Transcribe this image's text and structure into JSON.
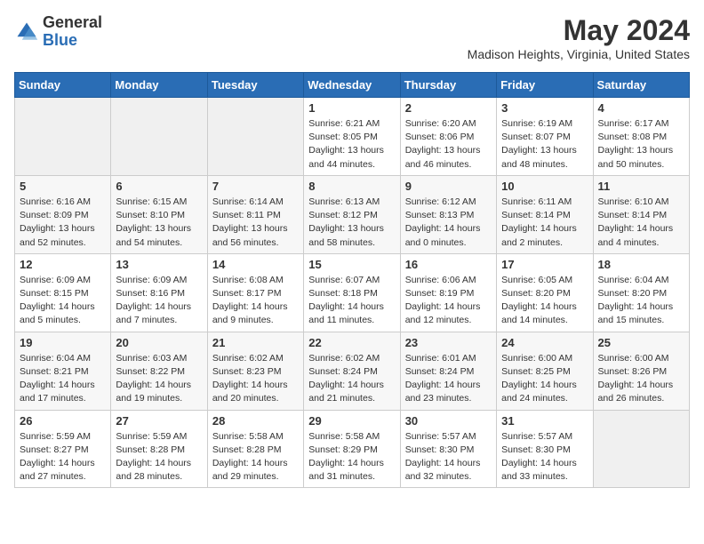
{
  "header": {
    "logo_general": "General",
    "logo_blue": "Blue",
    "month_year": "May 2024",
    "location": "Madison Heights, Virginia, United States"
  },
  "days_of_week": [
    "Sunday",
    "Monday",
    "Tuesday",
    "Wednesday",
    "Thursday",
    "Friday",
    "Saturday"
  ],
  "weeks": [
    [
      {
        "day": "",
        "info": ""
      },
      {
        "day": "",
        "info": ""
      },
      {
        "day": "",
        "info": ""
      },
      {
        "day": "1",
        "info": "Sunrise: 6:21 AM\nSunset: 8:05 PM\nDaylight: 13 hours and 44 minutes."
      },
      {
        "day": "2",
        "info": "Sunrise: 6:20 AM\nSunset: 8:06 PM\nDaylight: 13 hours and 46 minutes."
      },
      {
        "day": "3",
        "info": "Sunrise: 6:19 AM\nSunset: 8:07 PM\nDaylight: 13 hours and 48 minutes."
      },
      {
        "day": "4",
        "info": "Sunrise: 6:17 AM\nSunset: 8:08 PM\nDaylight: 13 hours and 50 minutes."
      }
    ],
    [
      {
        "day": "5",
        "info": "Sunrise: 6:16 AM\nSunset: 8:09 PM\nDaylight: 13 hours and 52 minutes."
      },
      {
        "day": "6",
        "info": "Sunrise: 6:15 AM\nSunset: 8:10 PM\nDaylight: 13 hours and 54 minutes."
      },
      {
        "day": "7",
        "info": "Sunrise: 6:14 AM\nSunset: 8:11 PM\nDaylight: 13 hours and 56 minutes."
      },
      {
        "day": "8",
        "info": "Sunrise: 6:13 AM\nSunset: 8:12 PM\nDaylight: 13 hours and 58 minutes."
      },
      {
        "day": "9",
        "info": "Sunrise: 6:12 AM\nSunset: 8:13 PM\nDaylight: 14 hours and 0 minutes."
      },
      {
        "day": "10",
        "info": "Sunrise: 6:11 AM\nSunset: 8:14 PM\nDaylight: 14 hours and 2 minutes."
      },
      {
        "day": "11",
        "info": "Sunrise: 6:10 AM\nSunset: 8:14 PM\nDaylight: 14 hours and 4 minutes."
      }
    ],
    [
      {
        "day": "12",
        "info": "Sunrise: 6:09 AM\nSunset: 8:15 PM\nDaylight: 14 hours and 5 minutes."
      },
      {
        "day": "13",
        "info": "Sunrise: 6:09 AM\nSunset: 8:16 PM\nDaylight: 14 hours and 7 minutes."
      },
      {
        "day": "14",
        "info": "Sunrise: 6:08 AM\nSunset: 8:17 PM\nDaylight: 14 hours and 9 minutes."
      },
      {
        "day": "15",
        "info": "Sunrise: 6:07 AM\nSunset: 8:18 PM\nDaylight: 14 hours and 11 minutes."
      },
      {
        "day": "16",
        "info": "Sunrise: 6:06 AM\nSunset: 8:19 PM\nDaylight: 14 hours and 12 minutes."
      },
      {
        "day": "17",
        "info": "Sunrise: 6:05 AM\nSunset: 8:20 PM\nDaylight: 14 hours and 14 minutes."
      },
      {
        "day": "18",
        "info": "Sunrise: 6:04 AM\nSunset: 8:20 PM\nDaylight: 14 hours and 15 minutes."
      }
    ],
    [
      {
        "day": "19",
        "info": "Sunrise: 6:04 AM\nSunset: 8:21 PM\nDaylight: 14 hours and 17 minutes."
      },
      {
        "day": "20",
        "info": "Sunrise: 6:03 AM\nSunset: 8:22 PM\nDaylight: 14 hours and 19 minutes."
      },
      {
        "day": "21",
        "info": "Sunrise: 6:02 AM\nSunset: 8:23 PM\nDaylight: 14 hours and 20 minutes."
      },
      {
        "day": "22",
        "info": "Sunrise: 6:02 AM\nSunset: 8:24 PM\nDaylight: 14 hours and 21 minutes."
      },
      {
        "day": "23",
        "info": "Sunrise: 6:01 AM\nSunset: 8:24 PM\nDaylight: 14 hours and 23 minutes."
      },
      {
        "day": "24",
        "info": "Sunrise: 6:00 AM\nSunset: 8:25 PM\nDaylight: 14 hours and 24 minutes."
      },
      {
        "day": "25",
        "info": "Sunrise: 6:00 AM\nSunset: 8:26 PM\nDaylight: 14 hours and 26 minutes."
      }
    ],
    [
      {
        "day": "26",
        "info": "Sunrise: 5:59 AM\nSunset: 8:27 PM\nDaylight: 14 hours and 27 minutes."
      },
      {
        "day": "27",
        "info": "Sunrise: 5:59 AM\nSunset: 8:28 PM\nDaylight: 14 hours and 28 minutes."
      },
      {
        "day": "28",
        "info": "Sunrise: 5:58 AM\nSunset: 8:28 PM\nDaylight: 14 hours and 29 minutes."
      },
      {
        "day": "29",
        "info": "Sunrise: 5:58 AM\nSunset: 8:29 PM\nDaylight: 14 hours and 31 minutes."
      },
      {
        "day": "30",
        "info": "Sunrise: 5:57 AM\nSunset: 8:30 PM\nDaylight: 14 hours and 32 minutes."
      },
      {
        "day": "31",
        "info": "Sunrise: 5:57 AM\nSunset: 8:30 PM\nDaylight: 14 hours and 33 minutes."
      },
      {
        "day": "",
        "info": ""
      }
    ]
  ]
}
